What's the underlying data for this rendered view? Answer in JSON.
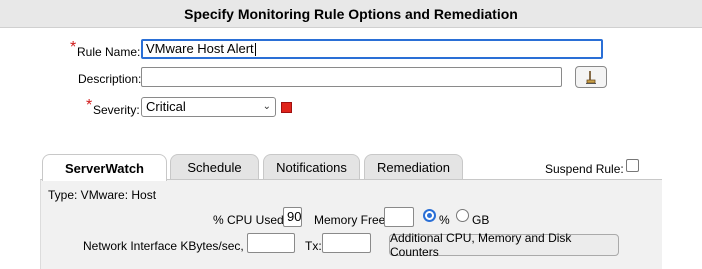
{
  "header": {
    "title": "Specify Monitoring Rule Options and Remediation"
  },
  "form": {
    "rule_name_label": "Rule Name:",
    "rule_name_value": "VMware Host Alert",
    "description_label": "Description:",
    "description_value": "",
    "severity_label": "Severity:",
    "severity_value": "Critical",
    "required_mark": "*",
    "severity_color": "#e0241b"
  },
  "tabs": [
    {
      "label": "ServerWatch",
      "active": true
    },
    {
      "label": "Schedule",
      "active": false
    },
    {
      "label": "Notifications",
      "active": false
    },
    {
      "label": "Remediation",
      "active": false
    }
  ],
  "suspend_rule": {
    "label": "Suspend Rule:",
    "checked": false
  },
  "serverwatch": {
    "type_label": "Type: VMware: Host",
    "cpu_label": "% CPU Used:",
    "cpu_value": "90",
    "memory_label": "Memory Free:",
    "memory_value": "",
    "unit_percent": "%",
    "unit_gb": "GB",
    "selected_unit": "%",
    "network_label": "Network Interface KBytes/sec, Rx:",
    "rx_value": "",
    "tx_label": "Tx:",
    "tx_value": "",
    "additional_button": "Additional CPU, Memory and Disk Counters"
  },
  "icons": {
    "description_button_icon": "broom-icon",
    "severity_dropdown_icon": "chevron-down-icon"
  }
}
